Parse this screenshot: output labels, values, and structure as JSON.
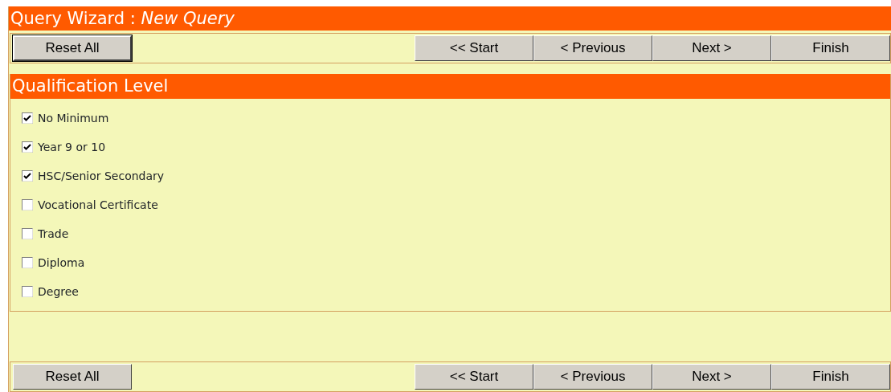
{
  "window": {
    "title": "Query Wizard : ",
    "subtitle": "New Query"
  },
  "top_toolbar": {
    "reset": {
      "label": "Reset All",
      "focused": true
    },
    "nav": [
      "<< Start",
      "< Previous",
      "Next >",
      "Finish"
    ]
  },
  "section": {
    "title": "Qualification Level",
    "options": [
      {
        "label": "No Minimum",
        "checked": true
      },
      {
        "label": "Year 9 or 10",
        "checked": true
      },
      {
        "label": "HSC/Senior Secondary",
        "checked": true
      },
      {
        "label": "Vocational Certificate",
        "checked": false
      },
      {
        "label": "Trade",
        "checked": false
      },
      {
        "label": "Diploma",
        "checked": false
      },
      {
        "label": "Degree",
        "checked": false
      }
    ]
  },
  "bottom_toolbar": {
    "reset": {
      "label": "Reset All",
      "focused": false
    },
    "nav": [
      "<< Start",
      "< Previous",
      "Next >",
      "Finish"
    ]
  }
}
